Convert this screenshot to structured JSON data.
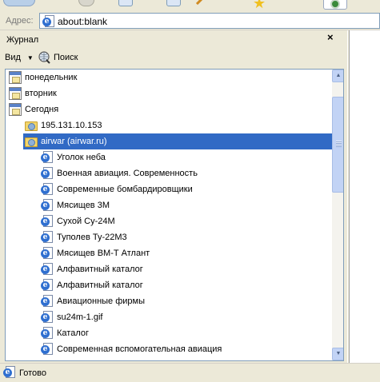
{
  "address_bar": {
    "label": "Адрес:",
    "url": "about:blank"
  },
  "history_panel": {
    "title": "Журнал",
    "close_glyph": "×",
    "view_label": "Вид",
    "search_label": "Поиск"
  },
  "history_items": [
    {
      "type": "day",
      "label": "понедельник",
      "indent": 0,
      "selected": false
    },
    {
      "type": "day",
      "label": "вторник",
      "indent": 0,
      "selected": false
    },
    {
      "type": "day",
      "label": "Сегодня",
      "indent": 0,
      "selected": false
    },
    {
      "type": "site",
      "label": "195.131.10.153",
      "indent": 1,
      "selected": false
    },
    {
      "type": "site",
      "label": "airwar (airwar.ru)",
      "indent": 1,
      "selected": true
    },
    {
      "type": "page",
      "label": "Уголок неба",
      "indent": 2,
      "selected": false
    },
    {
      "type": "page",
      "label": "Военная авиация. Современность",
      "indent": 2,
      "selected": false
    },
    {
      "type": "page",
      "label": "Современные бомбардировщики",
      "indent": 2,
      "selected": false
    },
    {
      "type": "page",
      "label": "Мясищев 3М",
      "indent": 2,
      "selected": false
    },
    {
      "type": "page",
      "label": "Сухой Су-24М",
      "indent": 2,
      "selected": false
    },
    {
      "type": "page",
      "label": "Туполев Ту-22М3",
      "indent": 2,
      "selected": false
    },
    {
      "type": "page",
      "label": "Мясищев ВМ-Т Атлант",
      "indent": 2,
      "selected": false
    },
    {
      "type": "page",
      "label": "Алфавитный каталог",
      "indent": 2,
      "selected": false
    },
    {
      "type": "page",
      "label": "Алфавитный каталог",
      "indent": 2,
      "selected": false
    },
    {
      "type": "page",
      "label": "Авиационные фирмы",
      "indent": 2,
      "selected": false
    },
    {
      "type": "page",
      "label": "su24m-1.gif",
      "indent": 2,
      "selected": false
    },
    {
      "type": "page",
      "label": "Каталог",
      "indent": 2,
      "selected": false
    },
    {
      "type": "page",
      "label": "Современная вспомогательная авиация",
      "indent": 2,
      "selected": false
    }
  ],
  "status_bar": {
    "text": "Готово"
  },
  "colors": {
    "selection": "#316ac5",
    "list_border": "#7f9db9",
    "chrome": "#ece9d8"
  }
}
